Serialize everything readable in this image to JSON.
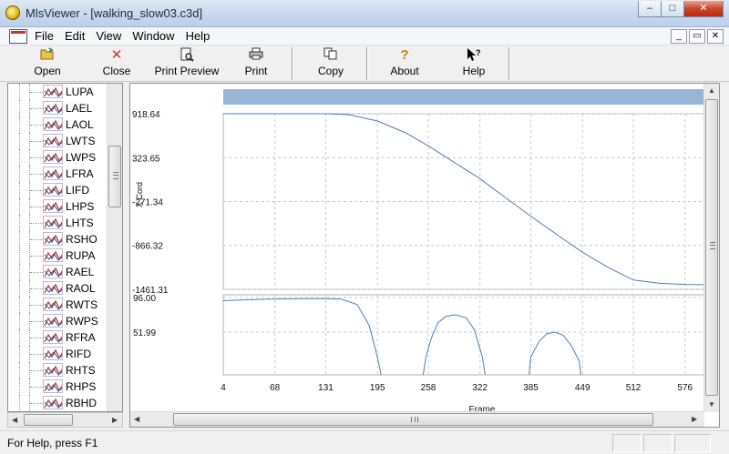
{
  "window": {
    "title": "MlsViewer - [walking_slow03.c3d]",
    "minimize": "–",
    "maximize": "□",
    "close": "✕"
  },
  "menu": {
    "items": [
      "File",
      "Edit",
      "View",
      "Window",
      "Help"
    ],
    "mdi": [
      "_",
      "▭",
      "✕"
    ]
  },
  "toolbar": {
    "buttons": [
      {
        "label": "Open",
        "icon": "open-folder-icon"
      },
      {
        "label": "Close",
        "icon": "red-x-icon"
      },
      {
        "label": "Print Preview",
        "icon": "print-preview-icon"
      },
      {
        "label": "Print",
        "icon": "printer-icon"
      },
      {
        "label": "Copy",
        "icon": "copy-icon"
      },
      {
        "label": "About",
        "icon": "question-mark-icon"
      },
      {
        "label": "Help",
        "icon": "help-pointer-icon"
      }
    ]
  },
  "tree": {
    "items": [
      "LUPA",
      "LAEL",
      "LAOL",
      "LWTS",
      "LWPS",
      "LFRA",
      "LIFD",
      "LHPS",
      "LHTS",
      "RSHO",
      "RUPA",
      "RAEL",
      "RAOL",
      "RWTS",
      "RWPS",
      "RFRA",
      "RIFD",
      "RHTS",
      "RHPS",
      "RBHD"
    ]
  },
  "chart_data": [
    {
      "type": "line",
      "ylabel": "X Cord",
      "yticks": [
        "918.64",
        "323.65",
        "-271.34",
        "-866.32",
        "-1461.31"
      ],
      "ylim": [
        -1461.31,
        918.64
      ],
      "xlim": [
        4,
        600
      ],
      "grid": true,
      "series": [
        {
          "x": [
            4,
            60,
            100,
            131,
            160,
            195,
            230,
            260,
            290,
            322,
            350,
            385,
            420,
            449,
            480,
            512,
            545,
            576,
            600
          ],
          "y": [
            918.64,
            918.64,
            918.64,
            918.64,
            905,
            820,
            660,
            470,
            260,
            40,
            -190,
            -470,
            -740,
            -960,
            -1160,
            -1335,
            -1380,
            -1395,
            -1400
          ]
        }
      ]
    },
    {
      "type": "line",
      "xlabel": "Frame",
      "yticks": [
        "96.00",
        "51.99"
      ],
      "xticks": [
        "4",
        "68",
        "131",
        "195",
        "258",
        "322",
        "385",
        "449",
        "512",
        "576"
      ],
      "xlim": [
        4,
        600
      ],
      "grid": true,
      "series": [
        {
          "x": [
            4,
            30,
            60,
            100,
            131,
            150,
            170,
            185,
            195,
            215,
            240,
            255,
            262,
            270,
            280,
            292,
            305,
            315,
            325,
            340,
            360,
            375,
            385,
            395,
            405,
            415,
            425,
            435,
            445,
            455
          ],
          "y": [
            92,
            93,
            94,
            94.5,
            94.5,
            94,
            87,
            60,
            20,
            -80,
            -80,
            20,
            45,
            64,
            72,
            74,
            70,
            55,
            20,
            -80,
            -80,
            -80,
            20,
            40,
            50,
            52,
            48,
            35,
            15,
            -80
          ]
        }
      ]
    }
  ],
  "status": {
    "text": "For Help, press F1"
  }
}
